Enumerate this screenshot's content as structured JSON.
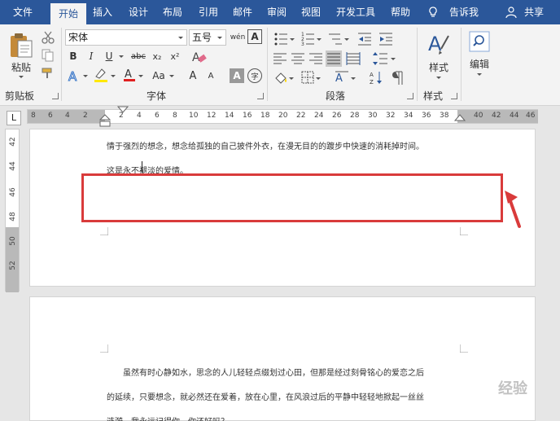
{
  "tabs": [
    {
      "id": "file",
      "label": "文件"
    },
    {
      "id": "home",
      "label": "开始"
    },
    {
      "id": "insert",
      "label": "插入"
    },
    {
      "id": "design",
      "label": "设计"
    },
    {
      "id": "layout",
      "label": "布局"
    },
    {
      "id": "references",
      "label": "引用"
    },
    {
      "id": "mailings",
      "label": "邮件"
    },
    {
      "id": "review",
      "label": "审阅"
    },
    {
      "id": "view",
      "label": "视图"
    },
    {
      "id": "developer",
      "label": "开发工具"
    },
    {
      "id": "help",
      "label": "帮助"
    }
  ],
  "tell_me": "告诉我",
  "share": "共享",
  "ribbon": {
    "clipboard": {
      "paste_label": "粘贴",
      "group_label": "剪贴板"
    },
    "font": {
      "font_name": "宋体",
      "font_size": "五号",
      "group_label": "字体",
      "bold": "B",
      "italic": "I",
      "underline": "U",
      "strike": "abc",
      "subscript": "x₂",
      "superscript": "x²",
      "grow": "A",
      "shrink": "A",
      "char_border": "A",
      "aa": "Aa",
      "wen": "wén",
      "enclose": "字"
    },
    "paragraph": {
      "group_label": "段落"
    },
    "styles": {
      "label": "样式",
      "group_label": "样式"
    },
    "editing": {
      "label": "编辑"
    }
  },
  "ruler": {
    "labels": [
      "8",
      "6",
      "4",
      "2",
      "",
      "2",
      "4",
      "6",
      "8",
      "10",
      "12",
      "14",
      "16",
      "18",
      "20",
      "22",
      "24",
      "26",
      "28",
      "30",
      "32",
      "34",
      "36",
      "38",
      "",
      "40",
      "42",
      "44",
      "46"
    ]
  },
  "vruler": {
    "labels": [
      "42",
      "44",
      "46",
      "48",
      "50",
      "52"
    ]
  },
  "page1": {
    "line1": "情于强烈的想念，想念给孤独的自己披件外衣，在漫无目的的踱步中快速的消耗掉时间。",
    "line2": "这是永不褪淡的爱情。"
  },
  "page2": {
    "line1": "虽然有时心静如水，思念的人儿轻轻点缀划过心田，但那是经过刻骨铭心的爱恋之后",
    "line2": "的延续，只要想念，就必然还在爱着，放在心里，在风浪过后的平静中轻轻地掀起一丝丝",
    "line3": "涟漪，我永远记得你，你还好吗？"
  },
  "watermark": "经验",
  "colors": {
    "accent": "#2b579a",
    "highlight_box": "#d93b3b"
  }
}
